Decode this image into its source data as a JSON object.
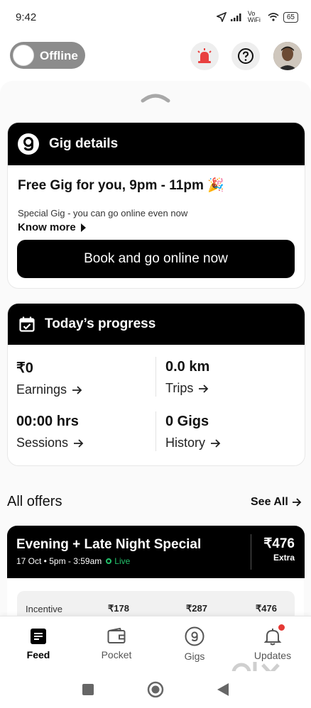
{
  "status_bar": {
    "time": "9:42",
    "network": "Vo WiFi",
    "battery": "65"
  },
  "top_bar": {
    "toggle_label": "Offline"
  },
  "gig_card": {
    "title": "Gig details",
    "headline": "Free Gig for you, 9pm - 11pm 🎉",
    "subtext": "Special Gig - you can go online even now",
    "know_more": "Know more",
    "cta": "Book and go online now"
  },
  "progress_card": {
    "title": "Today’s progress",
    "stats": [
      {
        "value": "₹0",
        "label": "Earnings"
      },
      {
        "value": "0.0 km",
        "label": "Trips"
      },
      {
        "value": "00:00 hrs",
        "label": "Sessions"
      },
      {
        "value": "0 Gigs",
        "label": "History"
      }
    ]
  },
  "offers": {
    "title": "All offers",
    "see_all": "See All",
    "card": {
      "title": "Evening + Late Night Special",
      "date": "17 Oct • 5pm - 3:59am",
      "live": "Live",
      "amount": "₹476",
      "extra": "Extra",
      "incentive_label": "Incentive",
      "incentive_values": [
        "₹178",
        "₹287",
        "₹476"
      ]
    }
  },
  "bottom_nav": [
    {
      "label": "Feed",
      "icon": "feed-icon",
      "active": true
    },
    {
      "label": "Pocket",
      "icon": "wallet-icon",
      "active": false
    },
    {
      "label": "Gigs",
      "icon": "gigs-logo-icon",
      "active": false
    },
    {
      "label": "Updates",
      "icon": "bell-icon",
      "active": false
    }
  ],
  "watermark": "olx",
  "colors": {
    "accent": "#000000",
    "live": "#23c16b",
    "alert": "#e8403f",
    "notification_dot": "#e53935"
  }
}
